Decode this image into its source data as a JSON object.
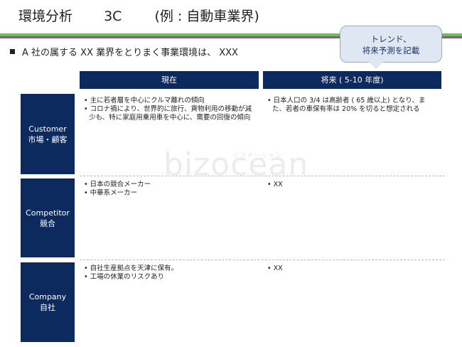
{
  "title": {
    "main": "環境分析",
    "sub": "3C",
    "example": "(例 : 自動車業界)"
  },
  "intro": "A 社の属する XX 業界をとりまく事業環境は、 XXX",
  "callout": {
    "line1": "トレンド、",
    "line2": "将来予測を記載"
  },
  "columns": {
    "current": "現在",
    "future": "将来 ( 5-10 年度)"
  },
  "rows": [
    {
      "label_en": "Customer",
      "label_ja": "市場・顧客",
      "current": [
        "• 主に若者層を中心にクルマ離れの傾向",
        "• コロナ禍により、世界的に旅行、貨物利用の移動が減少も、特に家庭用乗用車を中心に、需要の回復の傾向"
      ],
      "future": [
        "• 日本人口の 3/4 は高齢者 ( 65 歳以上) となり、また、若者の車保有率は 20% を切ると想定される"
      ]
    },
    {
      "label_en": "Competitor",
      "label_ja": "競合",
      "current": [
        "• 日本の競合メーカー",
        "• 中華系メーカー"
      ],
      "future": [
        "• XX"
      ]
    },
    {
      "label_en": "Company",
      "label_ja": "自社",
      "current": [
        "• 自社生産拠点を天津に保有。",
        "• 工場の休業のリスクあり"
      ],
      "future": [
        "• XX"
      ]
    }
  ],
  "watermark": {
    "main": "bizocean",
    "kana": "ビズオーシャン"
  },
  "colors": {
    "navy": "#0d2a5e",
    "green_bar": "#6cc04a",
    "purple_bar": "#a43fc2",
    "callout_bg": "#dfe8f2"
  }
}
